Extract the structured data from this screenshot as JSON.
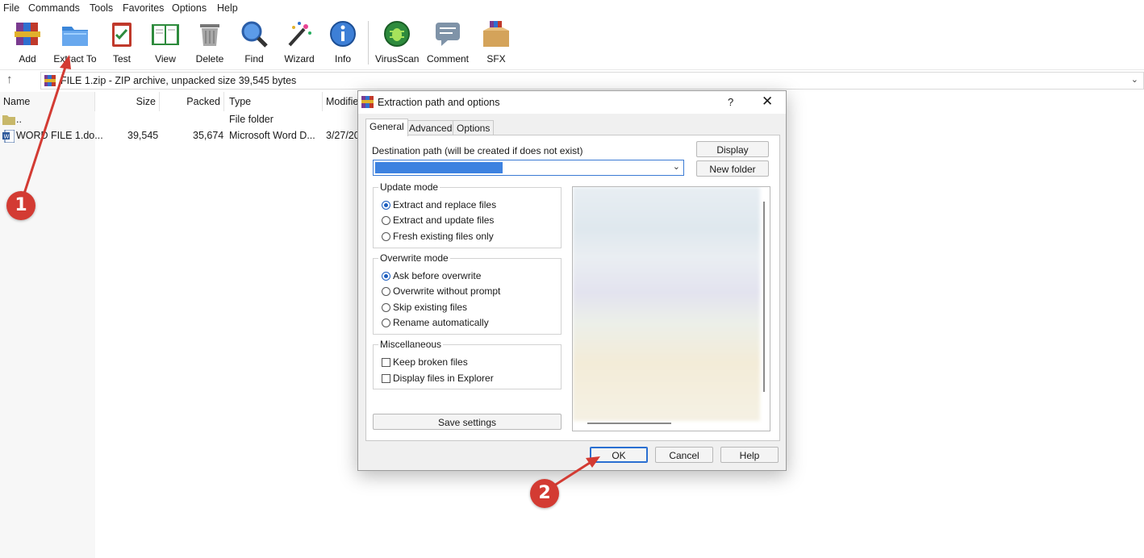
{
  "menu": [
    "File",
    "Commands",
    "Tools",
    "Favorites",
    "Options",
    "Help"
  ],
  "toolbar": {
    "add": "Add",
    "extract_to": "Extract To",
    "test": "Test",
    "view": "View",
    "delete": "Delete",
    "find": "Find",
    "wizard": "Wizard",
    "info": "Info",
    "virusscan": "VirusScan",
    "comment": "Comment",
    "sfx": "SFX"
  },
  "address": {
    "text": "FILE 1.zip - ZIP archive, unpacked size 39,545 bytes",
    "up_icon": "arrow-up-icon"
  },
  "columns": {
    "name": "Name",
    "size": "Size",
    "packed": "Packed",
    "type": "Type",
    "modified": "Modifie"
  },
  "files": [
    {
      "name": "..",
      "size": "",
      "packed": "",
      "type": "File folder",
      "modified": ""
    },
    {
      "name": "WORD FILE 1.do...",
      "size": "39,545",
      "packed": "35,674",
      "type": "Microsoft Word D...",
      "modified": "3/27/20"
    }
  ],
  "dialog": {
    "title": "Extraction path and options",
    "help_glyph": "?",
    "close_glyph": "✕",
    "tabs": [
      "General",
      "Advanced",
      "Options"
    ],
    "dest_label": "Destination path (will be created if does not exist)",
    "display_button": "Display",
    "new_folder_button": "New folder",
    "update_mode": {
      "title": "Update mode",
      "options": [
        "Extract and replace files",
        "Extract and update files",
        "Fresh existing files only"
      ],
      "selected": 0
    },
    "overwrite_mode": {
      "title": "Overwrite mode",
      "options": [
        "Ask before overwrite",
        "Overwrite without prompt",
        "Skip existing files",
        "Rename automatically"
      ],
      "selected": 0
    },
    "misc": {
      "title": "Miscellaneous",
      "options": [
        "Keep broken files",
        "Display files in Explorer"
      ]
    },
    "save_settings": "Save settings",
    "ok": "OK",
    "cancel": "Cancel",
    "help": "Help"
  },
  "markers": [
    "1",
    "2"
  ],
  "colors": {
    "accent": "#1e5fbf",
    "marker": "#d33b33",
    "selection": "#3d82e0"
  }
}
